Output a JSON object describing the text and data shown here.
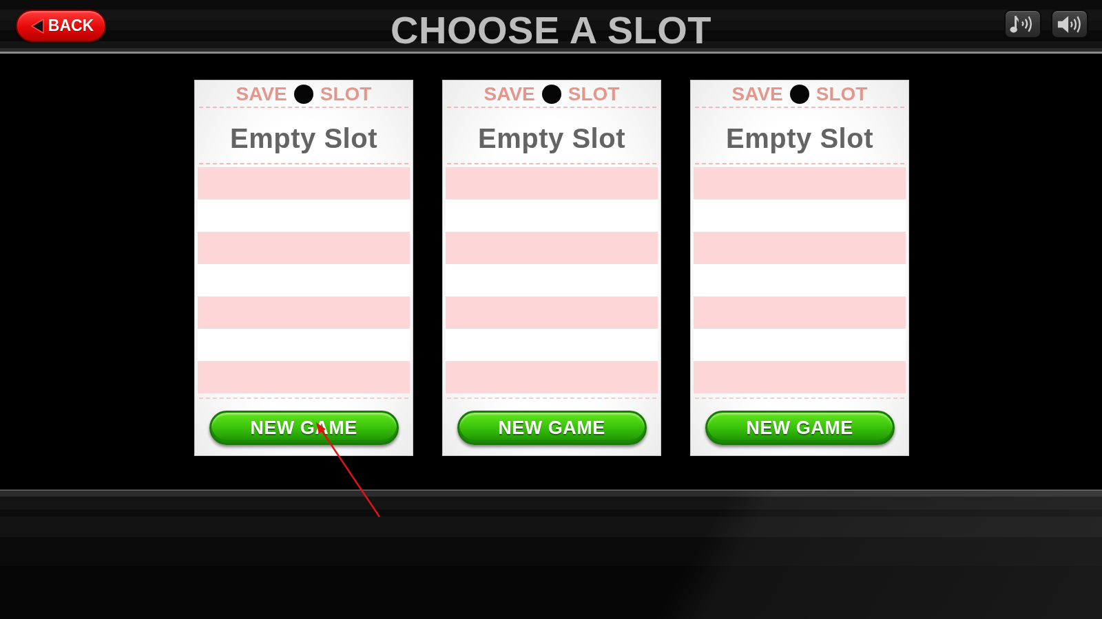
{
  "back_button": {
    "label": "BACK"
  },
  "title": "CHOOSE A SLOT",
  "slots": [
    {
      "label_before": "SAVE",
      "label_after": "SLOT",
      "status": "Empty Slot",
      "button": "NEW GAME",
      "pointer": true
    },
    {
      "label_before": "SAVE",
      "label_after": "SLOT",
      "status": "Empty Slot",
      "button": "NEW GAME",
      "pointer": false
    },
    {
      "label_before": "SAVE",
      "label_after": "SLOT",
      "status": "Empty Slot",
      "button": "NEW GAME",
      "pointer": false
    }
  ]
}
